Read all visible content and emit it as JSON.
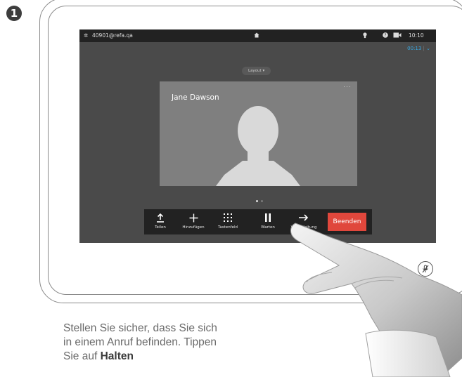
{
  "step": {
    "number": "1"
  },
  "status_bar": {
    "uri": "40901@refa.qa",
    "time": "10:10"
  },
  "call": {
    "duration": "00:13",
    "caller_name": "Jane Dawson",
    "layout_label": "Layout"
  },
  "call_bar": {
    "items": [
      {
        "label": "Teilen",
        "icon": "share-icon"
      },
      {
        "label": "Hinzufügen",
        "icon": "plus-icon"
      },
      {
        "label": "Tastenfeld",
        "icon": "keypad-icon"
      },
      {
        "label": "Warten",
        "icon": "pause-icon"
      },
      {
        "label": "Weiterleitung",
        "icon": "transfer-icon"
      }
    ],
    "end_label": "Beenden"
  },
  "instruction": {
    "text": "Stellen Sie sicher, dass Sie sich in einem Anruf befinden. Tippen Sie auf",
    "highlight": "Halten"
  },
  "colors": {
    "end_button": "#e0473c",
    "accent": "#38a6e0",
    "screen": "#4a4a4a",
    "status_bar": "#222222"
  }
}
